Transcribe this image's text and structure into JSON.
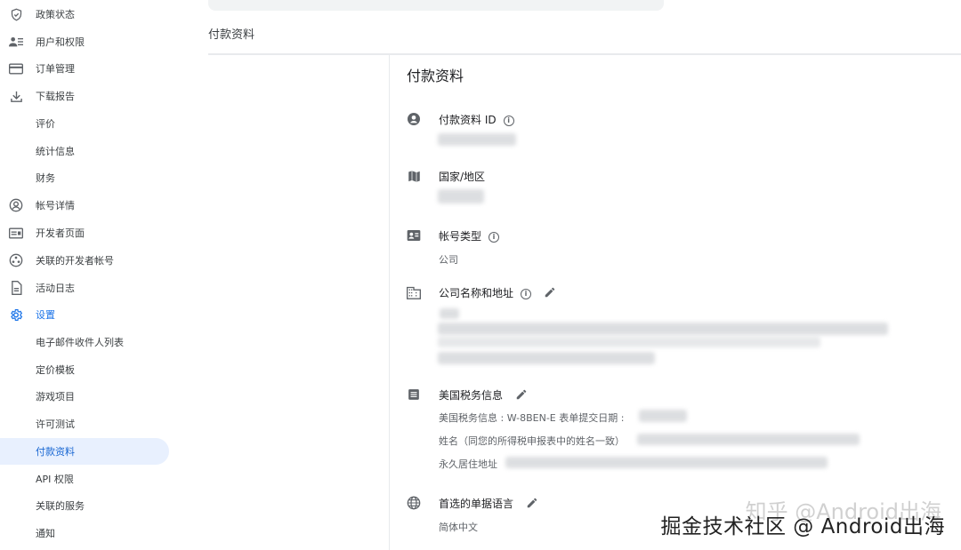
{
  "sidebar": {
    "items": [
      {
        "label": "政策状态",
        "icon": "shield-check-icon"
      },
      {
        "label": "用户和权限",
        "icon": "users-icon"
      },
      {
        "label": "订单管理",
        "icon": "credit-card-icon"
      },
      {
        "label": "下载报告",
        "icon": "download-icon"
      },
      {
        "label": "评价",
        "icon": ""
      },
      {
        "label": "统计信息",
        "icon": ""
      },
      {
        "label": "财务",
        "icon": ""
      },
      {
        "label": "帐号详情",
        "icon": "account-circle-icon"
      },
      {
        "label": "开发者页面",
        "icon": "web-page-icon"
      },
      {
        "label": "关联的开发者帐号",
        "icon": "linked-accounts-icon"
      },
      {
        "label": "活动日志",
        "icon": "document-icon"
      },
      {
        "label": "设置",
        "icon": "gear-icon"
      },
      {
        "label": "电子邮件收件人列表",
        "icon": ""
      },
      {
        "label": "定价模板",
        "icon": ""
      },
      {
        "label": "游戏项目",
        "icon": ""
      },
      {
        "label": "许可测试",
        "icon": ""
      },
      {
        "label": "付款资料",
        "icon": ""
      },
      {
        "label": "API 权限",
        "icon": ""
      },
      {
        "label": "关联的服务",
        "icon": ""
      },
      {
        "label": "通知",
        "icon": ""
      }
    ],
    "active_section": "设置",
    "selected_item": "付款资料"
  },
  "header": {
    "breadcrumb": "付款资料"
  },
  "main": {
    "title": "付款资料",
    "fields": {
      "profile_id": {
        "label": "付款资料 ID",
        "icon": "account-circle-icon"
      },
      "country": {
        "label": "国家/地区",
        "icon": "map-icon"
      },
      "account_type": {
        "label": "帐号类型",
        "icon": "contact-card-icon",
        "value": "公司"
      },
      "company": {
        "label": "公司名称和地址",
        "icon": "building-icon"
      },
      "tax": {
        "label": "美国税务信息",
        "icon": "list-icon",
        "line1": "美国税务信息 : W-8BEN-E 表单提交日期 :",
        "line2": "姓名（同您的所得税申报表中的姓名一致）",
        "line3": "永久居住地址"
      },
      "language": {
        "label": "首选的单据语言",
        "icon": "globe-icon",
        "value": "简体中文"
      }
    }
  },
  "watermark": {
    "text": "掘金技术社区 @ Android出海",
    "ghost_text": "知乎 @Android出海"
  },
  "colors": {
    "accent": "#1a73e8",
    "selected_bg": "#e8f0fe",
    "divider": "#e8eaed"
  }
}
